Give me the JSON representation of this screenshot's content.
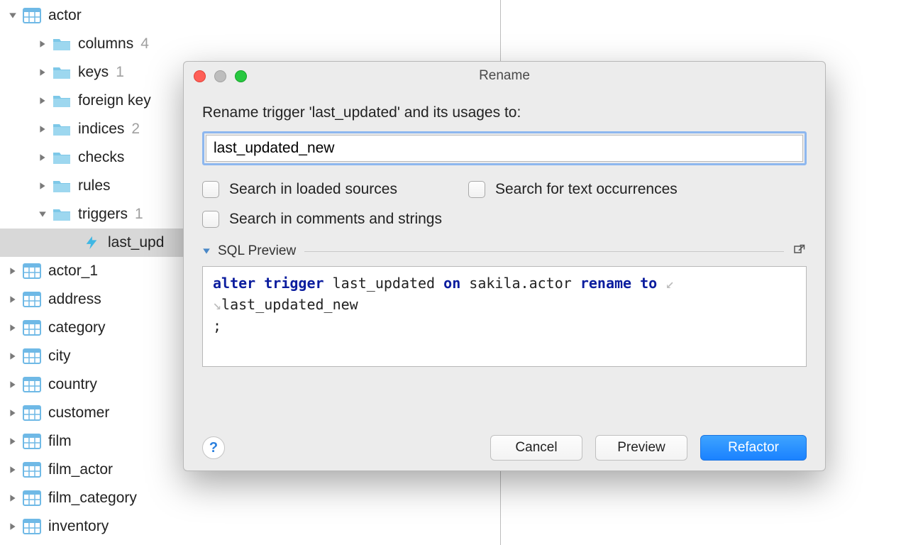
{
  "tree": {
    "actor": {
      "label": "actor"
    },
    "columns": {
      "label": "columns",
      "count": "4"
    },
    "keys": {
      "label": "keys",
      "count": "1"
    },
    "foreignkeys": {
      "label": "foreign key"
    },
    "indices": {
      "label": "indices",
      "count": "2"
    },
    "checks": {
      "label": "checks"
    },
    "rules": {
      "label": "rules"
    },
    "triggers": {
      "label": "triggers",
      "count": "1"
    },
    "trigger_item": {
      "label": "last_upd"
    },
    "actor_1": {
      "label": "actor_1"
    },
    "address": {
      "label": "address"
    },
    "category": {
      "label": "category"
    },
    "city": {
      "label": "city"
    },
    "country": {
      "label": "country"
    },
    "customer": {
      "label": "customer"
    },
    "film": {
      "label": "film"
    },
    "film_actor": {
      "label": "film_actor"
    },
    "film_category": {
      "label": "film_category"
    },
    "inventory": {
      "label": "inventory"
    }
  },
  "dialog": {
    "title": "Rename",
    "prompt": "Rename trigger 'last_updated' and its usages to:",
    "input_value": "last_updated_new",
    "chk1": "Search in loaded sources",
    "chk2": "Search for text occurrences",
    "chk3": "Search in comments and strings",
    "preview_header": "SQL Preview",
    "sql": {
      "kw1": "alter",
      "kw2": "trigger",
      "t1": "last_updated",
      "kw3": "on",
      "t2": "sakila.actor",
      "kw4": "rename",
      "kw5": "to",
      "line2": "last_updated_new",
      "semi": ";"
    },
    "help": "?",
    "btn_cancel": "Cancel",
    "btn_preview": "Preview",
    "btn_refactor": "Refactor"
  }
}
